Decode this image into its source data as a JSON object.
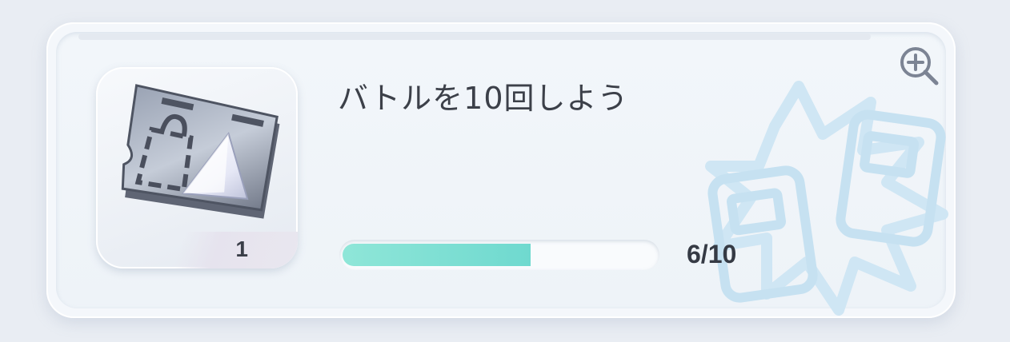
{
  "mission": {
    "title": "バトルを10回しよう",
    "reward": {
      "icon": "ticket-crystal-icon",
      "quantity": "1"
    },
    "progress": {
      "current": 6,
      "total": 10,
      "label": "6/10",
      "fraction": 0.6
    }
  },
  "icons": {
    "zoom": "zoom-in-icon",
    "background": "battle-cards-icon"
  },
  "colors": {
    "progress_fill": "#6fd9cf",
    "background_art": "#cfe6f4"
  }
}
